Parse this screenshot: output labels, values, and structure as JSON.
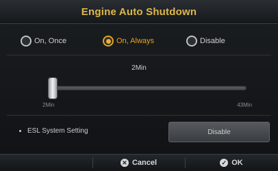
{
  "dialog": {
    "title": "Engine Auto Shutdown"
  },
  "modes": [
    {
      "label": "On, Once",
      "selected": false
    },
    {
      "label": "On, Always",
      "selected": true
    },
    {
      "label": "Disable",
      "selected": false
    }
  ],
  "slider": {
    "value_label": "2Min",
    "min_label": "2Min",
    "max_label": "43Min",
    "fraction": 0.0
  },
  "esl": {
    "label": "ESL System Setting",
    "button_label": "Disable"
  },
  "footer": {
    "cancel_label": "Cancel",
    "ok_label": "OK"
  },
  "colors": {
    "accent": "#e6a21f",
    "title": "#e0b84a"
  }
}
